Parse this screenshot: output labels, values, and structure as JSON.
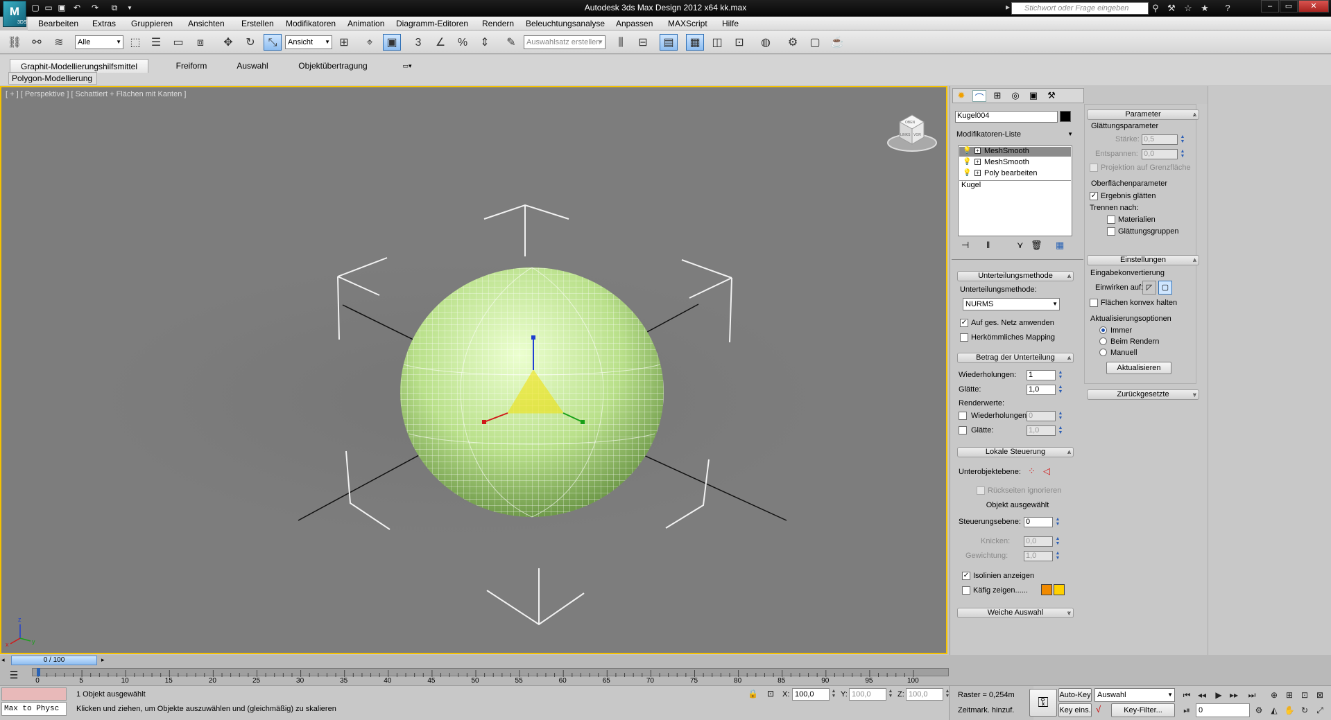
{
  "title_bar": {
    "logo_text": "",
    "logo_sub": "3DS",
    "title": "Autodesk 3ds Max Design 2012 x64      kk.max",
    "search_placeholder": "Stichwort oder Frage eingeben",
    "quick_access_icons": [
      "new-icon",
      "open-icon",
      "save-icon",
      "undo-icon",
      "redo-icon",
      "project-icon"
    ],
    "help_icons": [
      "binoculars-icon",
      "tools-icon",
      "star-icon",
      "help-icon"
    ]
  },
  "menu": [
    "Bearbeiten",
    "Extras",
    "Gruppieren",
    "Ansichten",
    "Erstellen",
    "Modifikatoren",
    "Animation",
    "Diagramm-Editoren",
    "Rendern",
    "Beleuchtungsanalyse",
    "Anpassen",
    "MAXScript",
    "Hilfe"
  ],
  "toolbar": {
    "selection_filter": "Alle",
    "ref_coord": "Ansicht",
    "named_selection": "Auswahlsatz erstellen"
  },
  "ribbon": {
    "tabs": [
      "Graphit-Modellierungshilfsmittel",
      "Freiform",
      "Auswahl",
      "Objektübertragung"
    ],
    "panel": "Polygon-Modellierung"
  },
  "viewport": {
    "label": "[ + ] [ Perspektive ] [ Schattiert + Flächen mit Kanten ]",
    "viewcube_front": "VOR",
    "viewcube_left": "LINKS",
    "viewcube_top": "OBEN",
    "axis_x": "x",
    "axis_y": "y",
    "axis_z": "z",
    "object_color": "#b9e08a"
  },
  "command_panel": {
    "object_name": "Kugel004",
    "modifier_list": "Modifikatoren-Liste",
    "stack": [
      "MeshSmooth",
      "MeshSmooth",
      "Poly bearbeiten",
      "Kugel"
    ],
    "subdivision_method": {
      "header": "Unterteilungsmethode",
      "label": "Unterteilungsmethode:",
      "value": "NURMS",
      "apply_whole": "Auf ges. Netz anwenden",
      "apply_whole_checked": true,
      "old_mapping": "Herkömmliches Mapping",
      "old_mapping_checked": false
    },
    "subdivision_amount": {
      "header": "Betrag der Unterteilung",
      "iterations_label": "Wiederholungen:",
      "iterations": "1",
      "smoothness_label": "Glätte:",
      "smoothness": "1,0",
      "render_label": "Renderwerte:",
      "render_iterations_label": "Wiederholungen:",
      "render_iterations": "0",
      "render_smoothness_label": "Glätte:",
      "render_smoothness": "1,0"
    },
    "local_control": {
      "header": "Lokale Steuerung",
      "subobject": "Unterobjektebene:",
      "ignore_backfacing": "Rückseiten ignorieren",
      "selected": "Objekt ausgewählt",
      "control_level_label": "Steuerungsebene:",
      "control_level": "0",
      "crease_label": "Knicken:",
      "crease": "0,0",
      "weight_label": "Gewichtung:",
      "weight": "1,0",
      "isolines": "Isolinien anzeigen",
      "isolines_checked": true,
      "show_cage": "Käfig zeigen......",
      "cage_color_1": "#f08a00",
      "cage_color_2": "#ffd000"
    },
    "soft_selection": "Weiche Auswahl"
  },
  "panel2": {
    "parameters": {
      "header": "Parameter",
      "smoothing_params": "Glättungsparameter",
      "strength_label": "Stärke:",
      "strength": "0,5",
      "relax_label": "Entspannen:",
      "relax": "0,0",
      "project_limit": "Projektion auf Grenzfläche",
      "surface_params": "Oberflächenparameter",
      "smooth_result": "Ergebnis glätten",
      "smooth_result_checked": true,
      "separate_by": "Trennen nach:",
      "materials": "Materialien",
      "smoothing_groups": "Glättungsgruppen"
    },
    "settings": {
      "header": "Einstellungen",
      "input_conversion": "Eingabekonvertierung",
      "operate_on": "Einwirken auf:",
      "keep_convex": "Flächen konvex halten",
      "update_options": "Aktualisierungsoptionen",
      "always": "Immer",
      "when_rendering": "Beim Rendern",
      "manually": "Manuell",
      "update_button": "Aktualisieren"
    },
    "resets": "Zurückgesetzte"
  },
  "timeline": {
    "slider": "0 / 100",
    "ticks": [
      "0",
      "5",
      "10",
      "15",
      "20",
      "25",
      "30",
      "35",
      "40",
      "45",
      "50",
      "55",
      "60",
      "65",
      "70",
      "75",
      "80",
      "85",
      "90",
      "95",
      "100"
    ]
  },
  "status": {
    "maxscript": "Max to Physc",
    "message1": "1 Objekt ausgewählt",
    "message2": "Klicken und ziehen, um Objekte auszuwählen und (gleichmäßig) zu skalieren",
    "x_label": "X:",
    "x": "100,0",
    "y_label": "Y:",
    "y": "100,0",
    "z_label": "Z:",
    "z": "100,0",
    "grid": "Raster = 0,254m",
    "add_time_tag": "Zeitmark. hinzuf.",
    "auto_key": "Auto-Key",
    "set_key": "Key eins.",
    "selection": "Auswahl",
    "key_filters": "Key-Filter...",
    "frame": "0"
  }
}
